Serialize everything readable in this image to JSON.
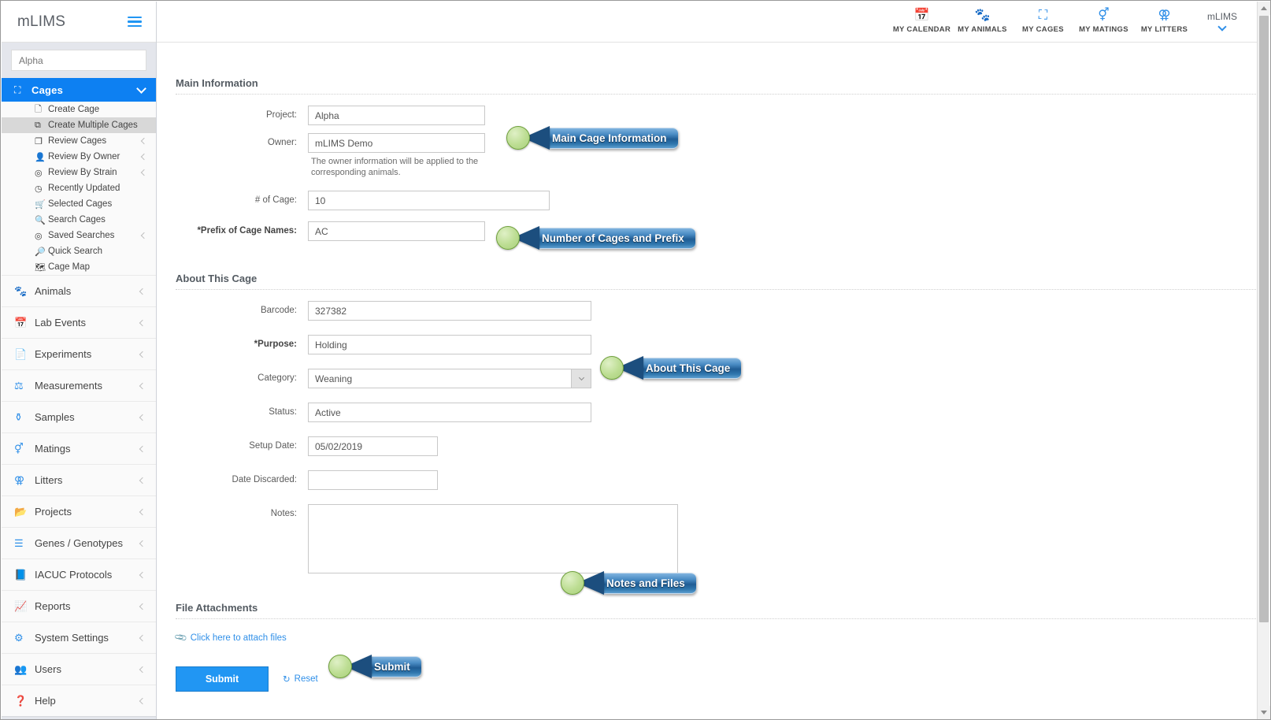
{
  "brand": {
    "name": "mLIMS",
    "menu_icon": "hamburger-icon"
  },
  "sidebar": {
    "search": {
      "value": "Alpha",
      "placeholder": "Alpha"
    },
    "group": {
      "label": "Cages",
      "icon": "cube-icon",
      "chevron": "chevron-down-icon",
      "items": [
        {
          "label": "Create Cage",
          "icon": "file-icon",
          "has_chevron": false,
          "active": false
        },
        {
          "label": "Create Multiple Cages",
          "icon": "copy-files-icon",
          "has_chevron": false,
          "active": true
        },
        {
          "label": "Review Cages",
          "icon": "duplicate-icon",
          "has_chevron": true,
          "active": false
        },
        {
          "label": "Review By Owner",
          "icon": "user-icon",
          "has_chevron": true,
          "active": false
        },
        {
          "label": "Review By Strain",
          "icon": "target-icon",
          "has_chevron": true,
          "active": false
        },
        {
          "label": "Recently Updated",
          "icon": "clock-icon",
          "has_chevron": false,
          "active": false
        },
        {
          "label": "Selected Cages",
          "icon": "cart-icon",
          "has_chevron": false,
          "active": false
        },
        {
          "label": "Search Cages",
          "icon": "magnifier-icon",
          "has_chevron": false,
          "active": false
        },
        {
          "label": "Saved Searches",
          "icon": "target-icon",
          "has_chevron": true,
          "active": false
        },
        {
          "label": "Quick Search",
          "icon": "magnifier-plus-icon",
          "has_chevron": false,
          "active": false
        },
        {
          "label": "Cage Map",
          "icon": "map-icon",
          "has_chevron": false,
          "active": false
        }
      ]
    },
    "main_items": [
      {
        "label": "Animals",
        "icon": "paw-icon",
        "chevron": "chevron-left-icon"
      },
      {
        "label": "Lab Events",
        "icon": "calendar-icon",
        "chevron": "chevron-left-icon"
      },
      {
        "label": "Experiments",
        "icon": "flask-doc-icon",
        "chevron": "chevron-left-icon"
      },
      {
        "label": "Measurements",
        "icon": "scale-icon",
        "chevron": "chevron-left-icon"
      },
      {
        "label": "Samples",
        "icon": "flask-icon",
        "chevron": "chevron-left-icon"
      },
      {
        "label": "Matings",
        "icon": "mating-icon",
        "chevron": "chevron-left-icon"
      },
      {
        "label": "Litters",
        "icon": "litter-icon",
        "chevron": "chevron-left-icon"
      },
      {
        "label": "Projects",
        "icon": "folder-icon",
        "chevron": "chevron-left-icon"
      },
      {
        "label": "Genes / Genotypes",
        "icon": "lines-icon",
        "chevron": "chevron-left-icon"
      },
      {
        "label": "IACUC Protocols",
        "icon": "book-icon",
        "chevron": "chevron-left-icon"
      },
      {
        "label": "Reports",
        "icon": "chart-line-icon",
        "chevron": "chevron-left-icon"
      },
      {
        "label": "System Settings",
        "icon": "gear-icon",
        "chevron": "chevron-left-icon"
      },
      {
        "label": "Users",
        "icon": "users-icon",
        "chevron": "chevron-left-icon"
      },
      {
        "label": "Help",
        "icon": "question-icon",
        "chevron": "chevron-left-icon"
      }
    ]
  },
  "topbar": {
    "items": [
      {
        "label": "MY CALENDAR",
        "icon": "calendar-icon"
      },
      {
        "label": "MY ANIMALS",
        "icon": "paw-icon"
      },
      {
        "label": "MY CAGES",
        "icon": "cube-icon"
      },
      {
        "label": "MY MATINGS",
        "icon": "mating-icon"
      },
      {
        "label": "MY LITTERS",
        "icon": "litter-icon"
      }
    ],
    "user": {
      "name": "mLIMS",
      "chevron": "chevron-down-icon"
    }
  },
  "form": {
    "main_information": {
      "title": "Main Information",
      "project": {
        "label": "Project:",
        "value": "Alpha"
      },
      "owner": {
        "label": "Owner:",
        "value": "mLIMS Demo",
        "helper": "The owner information will be applied to the corresponding animals."
      },
      "num_cage": {
        "label": "# of Cage:",
        "value": "10"
      },
      "prefix": {
        "label": "*Prefix of Cage Names:",
        "value": "AC"
      }
    },
    "about_this_cage": {
      "title": "About This Cage",
      "barcode": {
        "label": "Barcode:",
        "value": "327382"
      },
      "purpose": {
        "label": "*Purpose:",
        "value": "Holding"
      },
      "category": {
        "label": "Category:",
        "value": "Weaning",
        "dropdown_icon": "chevron-down-icon"
      },
      "status": {
        "label": "Status:",
        "value": "Active"
      },
      "setup_date": {
        "label": "Setup Date:",
        "value": "05/02/2019"
      },
      "date_discarded": {
        "label": "Date Discarded:",
        "value": ""
      },
      "notes": {
        "label": "Notes:",
        "value": ""
      }
    },
    "file_attachments": {
      "title": "File Attachments",
      "attach_link": "Click here to attach files",
      "attach_icon": "paperclip-icon"
    },
    "actions": {
      "submit_label": "Submit",
      "reset_label": "Reset",
      "reset_icon": "refresh-icon"
    }
  },
  "callouts": [
    {
      "text": "Main Cage Information"
    },
    {
      "text": "Number of Cages and Prefix"
    },
    {
      "text": "About This Cage"
    },
    {
      "text": "Notes and Files"
    },
    {
      "text": "Submit"
    }
  ],
  "colors": {
    "accent_blue": "#2196f3",
    "active_nav": "#0d80f2",
    "callout_green": "#bcdd92",
    "callout_blue": "#1f5c94"
  }
}
